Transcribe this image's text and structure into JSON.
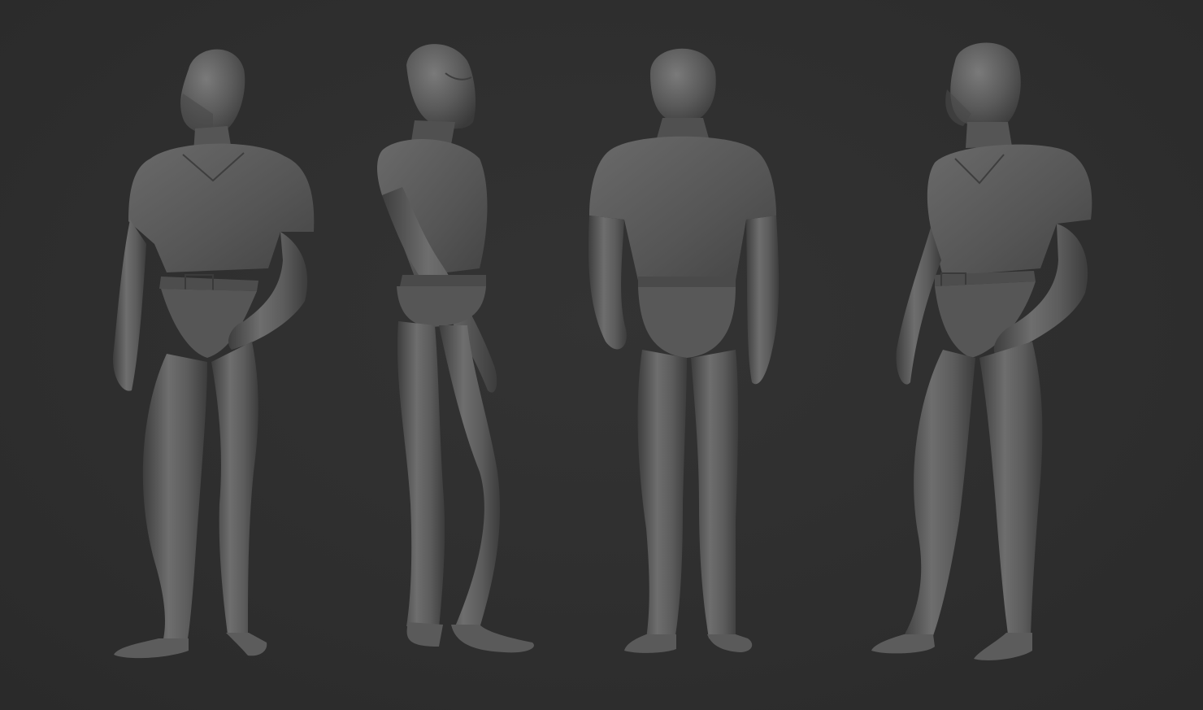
{
  "scene": {
    "description_colors": {
      "background": "#2f2f2f",
      "clay_base": "#5a5a5a",
      "clay_light": "#767676",
      "clay_dark": "#3c3c3c"
    },
    "views": [
      {
        "id": "front-three-quarter",
        "facing": "front-left"
      },
      {
        "id": "side-profile",
        "facing": "right"
      },
      {
        "id": "back",
        "facing": "back"
      },
      {
        "id": "front-three-quarter-mirrored",
        "facing": "front-left"
      }
    ]
  }
}
